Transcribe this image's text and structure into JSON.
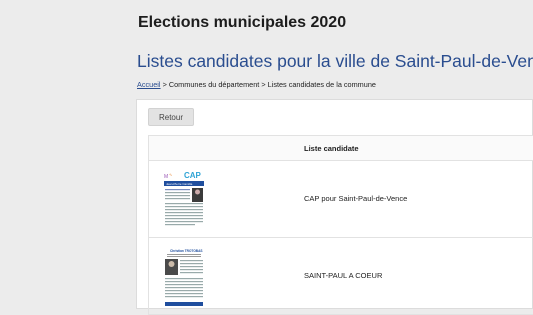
{
  "header": {
    "site_title": "Elections municipales 2020",
    "page_title": "Listes candidates pour la ville de Saint-Paul-de-Vence"
  },
  "breadcrumb": {
    "home": "Accueil",
    "separator": ">",
    "level2": "Communes du département",
    "level3": "Listes candidates de la commune"
  },
  "actions": {
    "back_label": "Retour"
  },
  "table": {
    "column_header": "Liste candidate",
    "rows": [
      {
        "name": "CAP pour Saint-Paul-de-Vence",
        "thumbnail": {
          "logo_text": "CAP",
          "heading": "Jean-Pierre Camilla"
        }
      },
      {
        "name": "SAINT-PAUL A COEUR",
        "thumbnail": {
          "logo_text": "",
          "heading": "Christian TROTOBAS"
        }
      }
    ]
  },
  "colors": {
    "page_bg": "#ececec",
    "title_blue": "#2a4d8f",
    "panel_bg": "#ffffff",
    "button_bg": "#e3e3e3"
  }
}
